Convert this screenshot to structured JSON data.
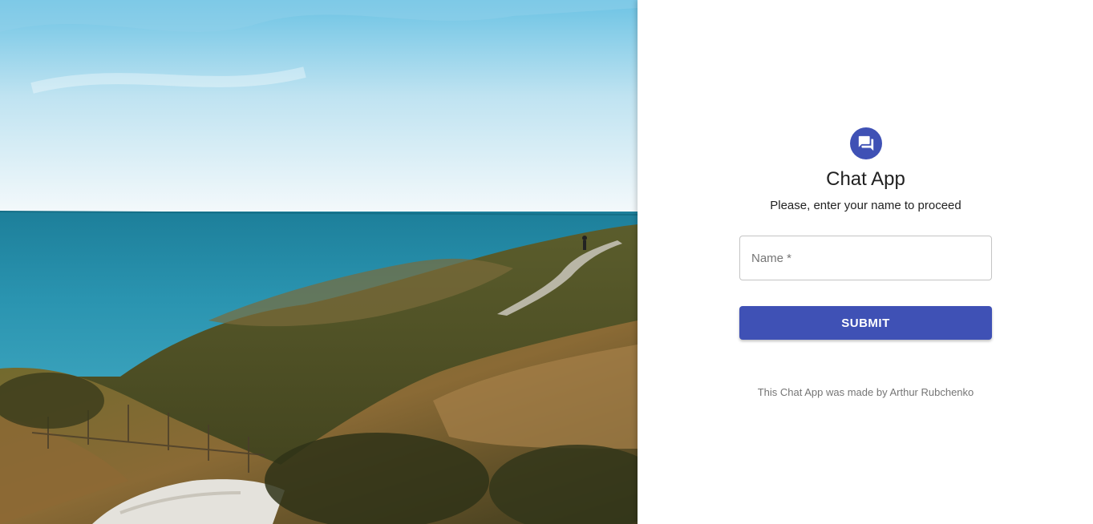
{
  "hero": {
    "image_name": "coastal-cliff-path-photo"
  },
  "form": {
    "icon": "chat-forum-icon",
    "title": "Chat App",
    "subtitle": "Please, enter your name to proceed",
    "name_label": "Name *",
    "submit_label": "SUBMIT",
    "credit": "This Chat App was made by Arthur Rubchenko"
  },
  "colors": {
    "primary": "#3f51b5",
    "text_secondary": "#757575"
  }
}
